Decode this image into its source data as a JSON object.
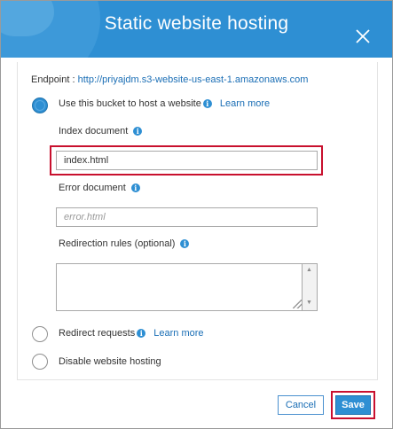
{
  "dialog": {
    "title": "Static website hosting"
  },
  "endpoint": {
    "label": "Endpoint :",
    "url": "http://priyajdm.s3-website-us-east-1.amazonaws.com"
  },
  "options": {
    "host": {
      "label": "Use this bucket to host a website",
      "learn_more": "Learn more",
      "selected": true
    },
    "redirect": {
      "label": "Redirect requests",
      "learn_more": "Learn more",
      "selected": false
    },
    "disable": {
      "label": "Disable website hosting",
      "selected": false
    }
  },
  "fields": {
    "index_document": {
      "label": "Index document",
      "value": "index.html"
    },
    "error_document": {
      "label": "Error document",
      "value": "",
      "placeholder": "error.html"
    },
    "redirection_rules": {
      "label": "Redirection rules (optional)",
      "value": ""
    }
  },
  "buttons": {
    "cancel": "Cancel",
    "save": "Save"
  },
  "colors": {
    "header": "#2e8fd3",
    "link": "#1a6eb5",
    "highlight": "#c8102e"
  },
  "icons": {
    "info": "i",
    "close": "close-icon"
  }
}
